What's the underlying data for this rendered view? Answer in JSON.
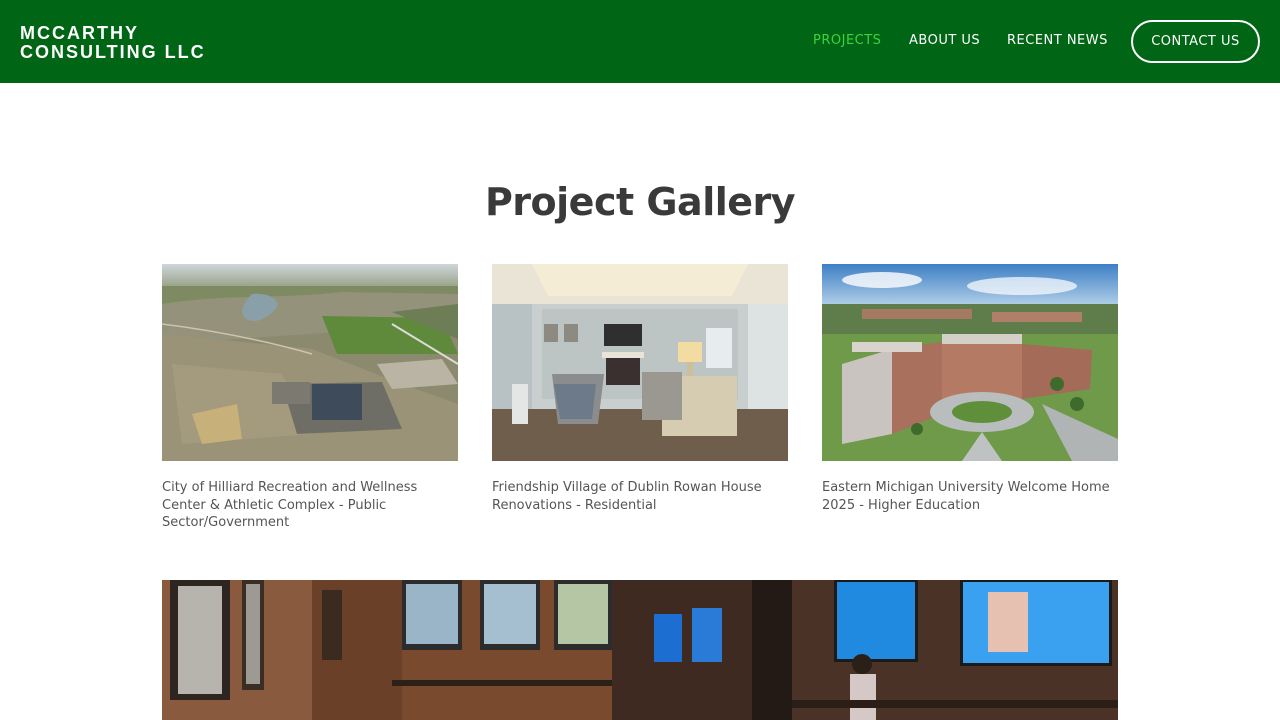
{
  "header": {
    "logo_line1": "MCCARTHY",
    "logo_line2": "CONSULTING LLC",
    "background_color": "#006616",
    "active_color": "#3ed13e",
    "nav": [
      {
        "label": "PROJECTS",
        "active": true
      },
      {
        "label": "ABOUT US",
        "active": false
      },
      {
        "label": "RECENT NEWS",
        "active": false
      }
    ],
    "contact_label": "CONTACT US"
  },
  "main": {
    "title": "Project Gallery",
    "projects": [
      {
        "caption": "City of Hilliard Recreation and Wellness Center & Athletic Complex - Public Sector/Government",
        "image": "aerial-construction-site-photo"
      },
      {
        "caption": "Friendship Village of Dublin Rowan House Renovations - Residential",
        "image": "living-room-interior-photo"
      },
      {
        "caption": "Eastern Michigan University Welcome Home 2025 - Higher Education",
        "image": "campus-residence-rendering"
      }
    ],
    "featured_image": "restaurant-bar-interior-photo"
  }
}
